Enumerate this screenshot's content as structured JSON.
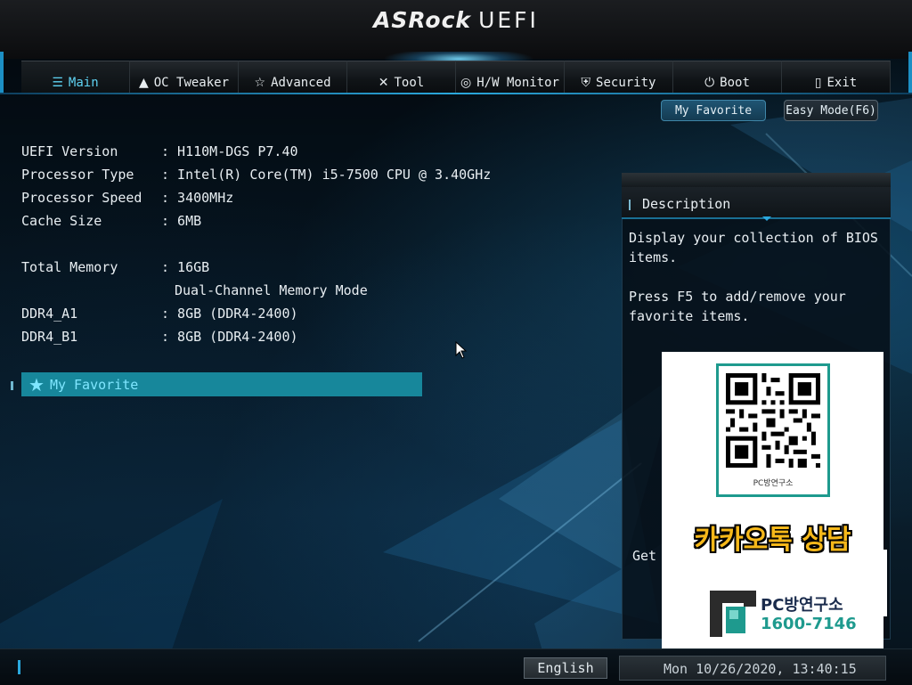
{
  "header": {
    "logo_brand": "ASRock",
    "logo_product": "UEFI"
  },
  "tabs": [
    {
      "label": "Main",
      "icon": "list-icon",
      "active": true
    },
    {
      "label": "OC Tweaker",
      "icon": "rocket-icon",
      "active": false
    },
    {
      "label": "Advanced",
      "icon": "star-outline-icon",
      "active": false
    },
    {
      "label": "Tool",
      "icon": "tools-icon",
      "active": false
    },
    {
      "label": "H/W Monitor",
      "icon": "monitor-gauge-icon",
      "active": false
    },
    {
      "label": "Security",
      "icon": "shield-icon",
      "active": false
    },
    {
      "label": "Boot",
      "icon": "power-icon",
      "active": false
    },
    {
      "label": "Exit",
      "icon": "exit-door-icon",
      "active": false
    }
  ],
  "top_buttons": {
    "my_favorite": "My Favorite",
    "easy_mode": "Easy Mode(F6)"
  },
  "info": {
    "uefi_version": {
      "label": "UEFI Version",
      "value": ": H110M-DGS P7.40"
    },
    "processor_type": {
      "label": "Processor Type",
      "value": ": Intel(R) Core(TM) i5-7500 CPU @ 3.40GHz"
    },
    "processor_speed": {
      "label": "Processor Speed",
      "value": ": 3400MHz"
    },
    "cache_size": {
      "label": "Cache Size",
      "value": ": 6MB"
    },
    "total_memory": {
      "label": "Total Memory",
      "value": ": 16GB"
    },
    "memory_mode": {
      "value": "Dual-Channel Memory Mode"
    },
    "ddr4_a1": {
      "label": "DDR4_A1",
      "value": ": 8GB (DDR4-2400)"
    },
    "ddr4_b1": {
      "label": "DDR4_B1",
      "value": ": 8GB (DDR4-2400)"
    }
  },
  "favorite_item": {
    "label": "My Favorite",
    "icon": "star-icon"
  },
  "description": {
    "title": "Description",
    "line1": "Display your collection of BIOS",
    "line2": "items.",
    "line3": "Press F5 to add/remove your",
    "line4": "favorite items.",
    "get": "Get"
  },
  "ad_overlay": {
    "qr_caption": "PC방연구소",
    "kakao": "카카오톡 상담",
    "brand": "PC방연구소",
    "phone": "1600-7146"
  },
  "footer": {
    "language": "English",
    "datetime": "Mon 10/26/2020, 13:40:15"
  },
  "colors": {
    "accent": "#2aa8dd",
    "favorite_bar": "#17879b",
    "active_tab_text": "#5fd3f3"
  }
}
